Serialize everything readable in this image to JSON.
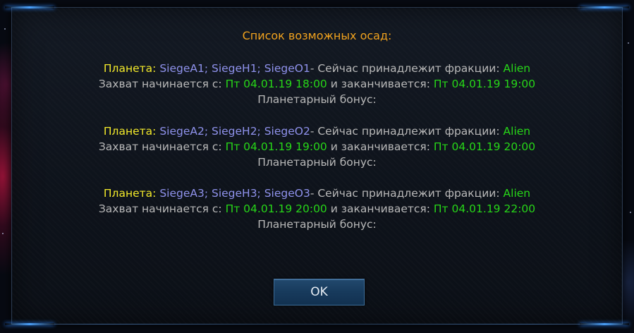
{
  "dialog": {
    "title": "Список возможных осад:",
    "entries": [
      {
        "planet_label": "Планета:",
        "planets": "SiegeA1; SiegeH1; SiegeO1",
        "owner_text": "- Сейчас принадлежит фракции:",
        "faction": "Alien",
        "start_text": "Захват начинается с:",
        "start_time": "Пт 04.01.19 18:00",
        "end_text": "и заканчивается:",
        "end_time": "Пт 04.01.19 19:00",
        "bonus_text": "Планетарный бонус:"
      },
      {
        "planet_label": "Планета:",
        "planets": "SiegeA2; SiegeH2; SiegeO2",
        "owner_text": "- Сейчас принадлежит фракции:",
        "faction": "Alien",
        "start_text": "Захват начинается с:",
        "start_time": "Пт 04.01.19 19:00",
        "end_text": "и заканчивается:",
        "end_time": "Пт 04.01.19 20:00",
        "bonus_text": "Планетарный бонус:"
      },
      {
        "planet_label": "Планета:",
        "planets": "SiegeA3; SiegeH3; SiegeO3",
        "owner_text": "- Сейчас принадлежит фракции:",
        "faction": "Alien",
        "start_text": "Захват начинается с:",
        "start_time": "Пт 04.01.19 20:00",
        "end_text": "и заканчивается:",
        "end_time": "Пт 04.01.19 22:00",
        "bonus_text": "Планетарный бонус:"
      }
    ],
    "ok_label": "OK"
  },
  "colors": {
    "title": "#f0a21e",
    "planet_label": "#f2e92a",
    "planet_names": "#8f92ec",
    "highlight": "#27d618",
    "body_text": "#b9b9b9",
    "button_bg": "#173a5c"
  }
}
